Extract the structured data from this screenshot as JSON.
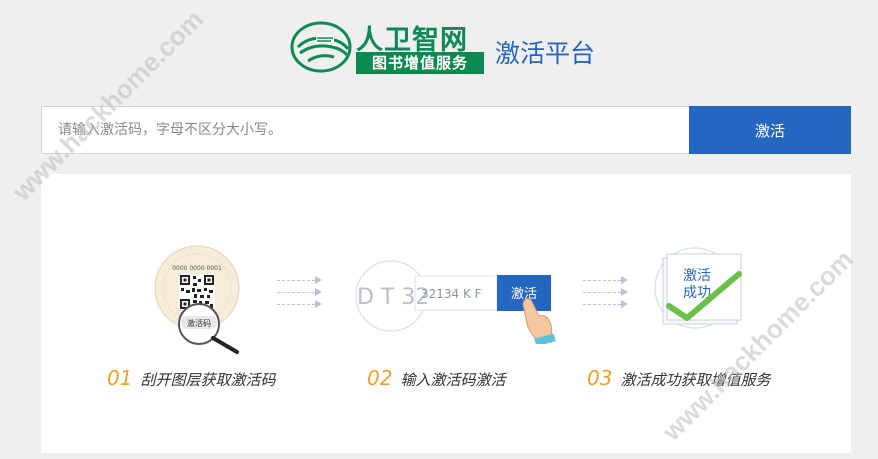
{
  "header": {
    "logo_text_1": "人卫智网",
    "logo_band": "图书增值服务",
    "platform_title": "激活平台"
  },
  "search": {
    "placeholder": "请输入激活码，字母不区分大小写。",
    "button_label": "激活"
  },
  "steps": [
    {
      "num": "01",
      "label": "刮开图层获取激活码",
      "badge": "激活码",
      "code_top": "0000 0000 0001"
    },
    {
      "num": "02",
      "label": "输入激活码激活",
      "code_big": "D T 32",
      "code_small": "32134 K F",
      "button": "激活"
    },
    {
      "num": "03",
      "label": "激活成功获取增值服务",
      "stamp_line1": "激活",
      "stamp_line2": "成功"
    }
  ],
  "watermark": "www.hackhome.com",
  "colors": {
    "brand_blue": "#2367c1",
    "brand_green": "#0d8a4f",
    "accent_orange": "#f0a030",
    "check_green": "#6cc04a"
  }
}
